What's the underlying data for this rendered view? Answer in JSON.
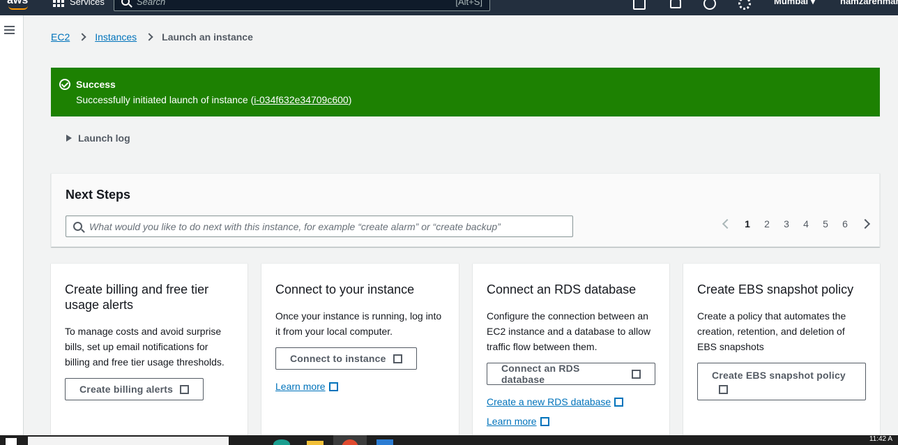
{
  "topnav": {
    "logo": "aws",
    "services_label": "Services",
    "search_placeholder": "Search",
    "search_shortcut": "[Alt+S]",
    "region": "Mumbai ▾",
    "user": "namzarenmans"
  },
  "breadcrumb": {
    "items": [
      "EC2",
      "Instances"
    ],
    "current": "Launch an instance"
  },
  "flash": {
    "type": "success",
    "color": "#1d8102",
    "title": "Success",
    "message_prefix": "Successfully initiated launch of instance (",
    "instance_id": "i-034f632e34709c600",
    "message_suffix": ")"
  },
  "launch_log": {
    "label": "Launch log"
  },
  "next_steps": {
    "title": "Next Steps",
    "search_placeholder": "What would you like to do next with this instance, for example “create alarm” or “create backup”",
    "pages": [
      "1",
      "2",
      "3",
      "4",
      "5",
      "6"
    ],
    "current_page": "1"
  },
  "cards": [
    {
      "title": "Create billing and free tier usage alerts",
      "description": "To manage costs and avoid surprise bills, set up email notifications for billing and free tier usage thresholds.",
      "button": "Create billing alerts"
    },
    {
      "title": "Connect to your instance",
      "description": "Once your instance is running, log into it from your local computer.",
      "button": "Connect to instance",
      "link": "Learn more"
    },
    {
      "title": "Connect an RDS database",
      "description": "Configure the connection between an EC2 instance and a database to allow traffic flow between them.",
      "button": "Connect an RDS database",
      "link": "Create a new RDS database",
      "link2": "Learn more"
    },
    {
      "title": "Create EBS snapshot policy",
      "description": "Create a policy that automates the creation, retention, and deletion of EBS snapshots",
      "button": "Create EBS snapshot policy"
    }
  ],
  "taskbar": {
    "clock": "11:42 A"
  },
  "colors": {
    "nav_bg": "#232f3e",
    "link": "#0073bb",
    "success": "#1d8102",
    "page_bg": "#f2f3f3"
  }
}
